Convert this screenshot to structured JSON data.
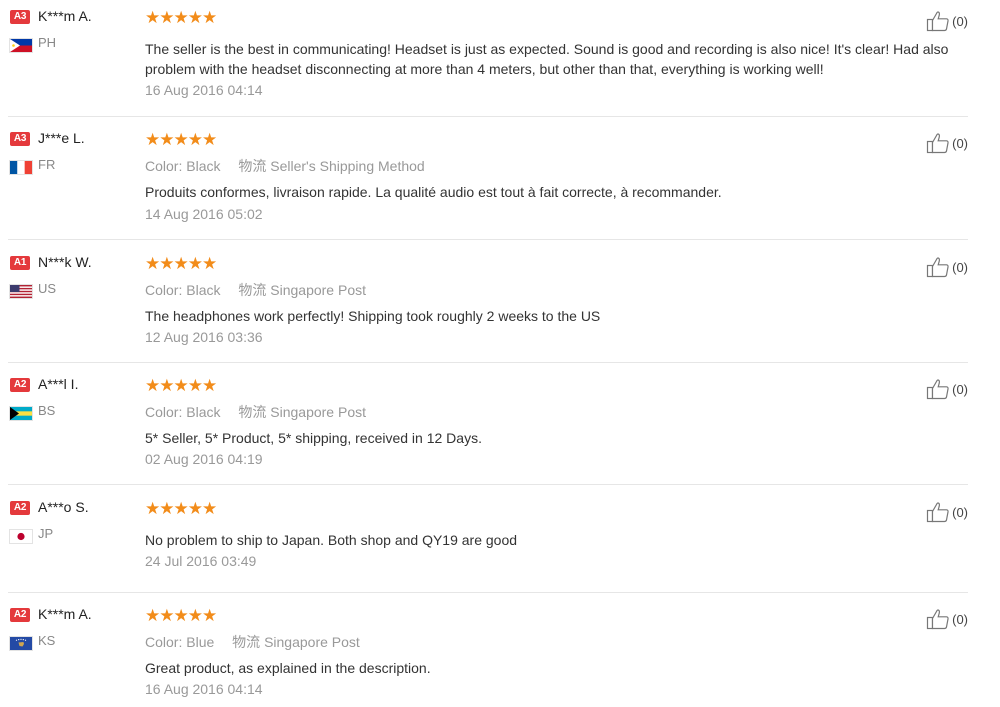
{
  "reviews": [
    {
      "level": "A3",
      "name": "K***m A.",
      "country": "PH",
      "flag": "flag-ph",
      "rating": "★★★★★",
      "color_label": "",
      "color_value": "",
      "shipping_label": "",
      "shipping_value": "",
      "text": "The seller is the best in communicating! Headset is just as expected. Sound is good and recording is also nice! It's clear! Had also problem with the headset disconnecting at more than 4 meters, but other than that, everything is working well!",
      "date": "16 Aug 2016 04:14",
      "helpful": "(0)"
    },
    {
      "level": "A3",
      "name": "J***e L.",
      "country": "FR",
      "flag": "flag-fr",
      "rating": "★★★★★",
      "color_label": "Color:",
      "color_value": "Black",
      "shipping_label": "物流",
      "shipping_value": "Seller's Shipping Method",
      "text": "Produits conformes, livraison rapide. La qualité audio est tout à fait correcte, à recommander.",
      "date": "14 Aug 2016 05:02",
      "helpful": "(0)"
    },
    {
      "level": "A1",
      "name": "N***k W.",
      "country": "US",
      "flag": "flag-us",
      "rating": "★★★★★",
      "color_label": "Color:",
      "color_value": "Black",
      "shipping_label": "物流",
      "shipping_value": "Singapore Post",
      "text": "The headphones work perfectly! Shipping took roughly 2 weeks to the US",
      "date": "12 Aug 2016 03:36",
      "helpful": "(0)"
    },
    {
      "level": "A2",
      "name": "A***l I.",
      "country": "BS",
      "flag": "flag-bs",
      "rating": "★★★★★",
      "color_label": "Color:",
      "color_value": "Black",
      "shipping_label": "物流",
      "shipping_value": "Singapore Post",
      "text": "5* Seller, 5* Product, 5* shipping, received in 12 Days.",
      "date": "02 Aug 2016 04:19",
      "helpful": "(0)"
    },
    {
      "level": "A2",
      "name": "A***o S.",
      "country": "JP",
      "flag": "flag-jp",
      "rating": "★★★★★",
      "color_label": "",
      "color_value": "",
      "shipping_label": "",
      "shipping_value": "",
      "text": "No problem to ship to Japan. Both shop and QY19 are good",
      "date": "24 Jul 2016 03:49",
      "helpful": "(0)"
    },
    {
      "level": "A2",
      "name": "K***m A.",
      "country": "KS",
      "flag": "flag-ks",
      "rating": "★★★★★",
      "color_label": "Color:",
      "color_value": "Blue",
      "shipping_label": "物流",
      "shipping_value": "Singapore Post",
      "text": "Great product, as explained in the description.",
      "date": "16 Aug 2016 04:14",
      "helpful": "(0)"
    }
  ],
  "colors": {
    "level_badge": "#e4393c",
    "stars": "#f28c1a",
    "muted": "#999999",
    "text": "#333333"
  },
  "icons": {
    "helpful": "thumbs-up-icon"
  }
}
